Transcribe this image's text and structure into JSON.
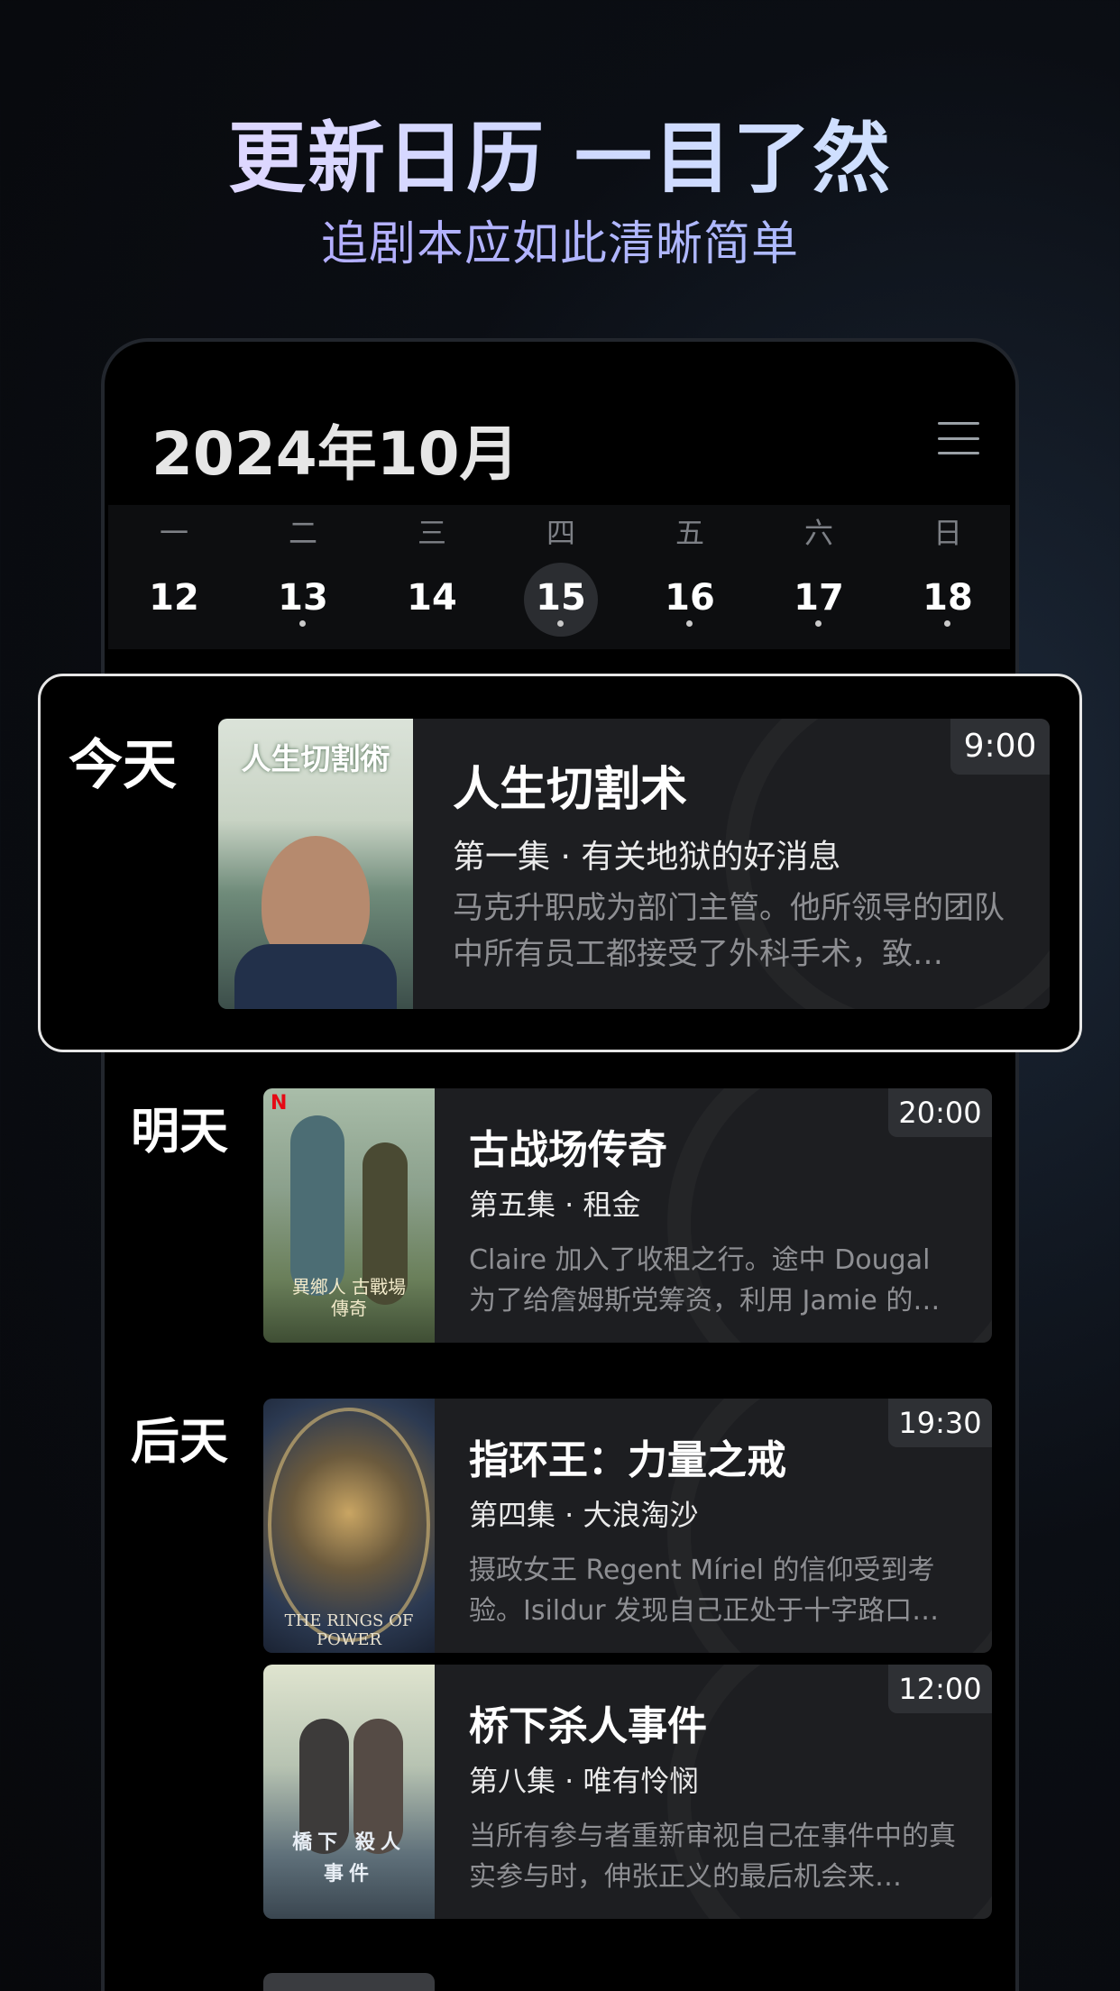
{
  "hero": {
    "title": "更新日历 一目了然",
    "subtitle": "追剧本应如此清晰简单"
  },
  "calendar": {
    "month_title": "2024年10月",
    "menu_icon": "menu-icon",
    "weekdays": [
      "一",
      "二",
      "三",
      "四",
      "五",
      "六",
      "日"
    ],
    "days": [
      "12",
      "13",
      "14",
      "15",
      "16",
      "17",
      "18"
    ],
    "selected_day": "15",
    "days_with_dots": [
      "13",
      "15",
      "16",
      "17",
      "18"
    ]
  },
  "schedule": [
    {
      "day_label": "今天",
      "shows": [
        {
          "poster_title": "人生切割術",
          "title": "人生切割术",
          "episode": "第一集 · 有关地狱的好消息",
          "description": "马克升职成为部门主管。他所领导的团队中所有员工都接受了外科手术，致…",
          "time": "9:00"
        }
      ]
    },
    {
      "day_label": "明天",
      "shows": [
        {
          "poster_title": "異鄉人 古戰場傳奇",
          "poster_badge": "N",
          "title": "古战场传奇",
          "episode": "第五集 · 租金",
          "description": "Claire 加入了收租之行。途中 Dougal 为了给詹姆斯党筹资，利用 Jamie 的…",
          "time": "20:00"
        }
      ]
    },
    {
      "day_label": "后天",
      "shows": [
        {
          "poster_title": "THE RINGS OF POWER",
          "title": "指环王：力量之戒",
          "episode": "第四集 · 大浪淘沙",
          "description": "摄政女王 Regent Míriel 的信仰受到考验。Isildur 发现自己正处于十字路口…",
          "time": "19:30"
        },
        {
          "poster_title": "橋下 殺人事件",
          "title": "桥下杀人事件",
          "episode": "第八集 · 唯有怜悯",
          "description": "当所有参与者重新审视自己在事件中的真实参与时，伸张正义的最后机会来…",
          "time": "12:00"
        }
      ]
    }
  ],
  "colors": {
    "background": "#07080b",
    "card": "#1d1e21",
    "accent_gradient": [
      "#e9d6ff",
      "#cfe6ff"
    ]
  }
}
